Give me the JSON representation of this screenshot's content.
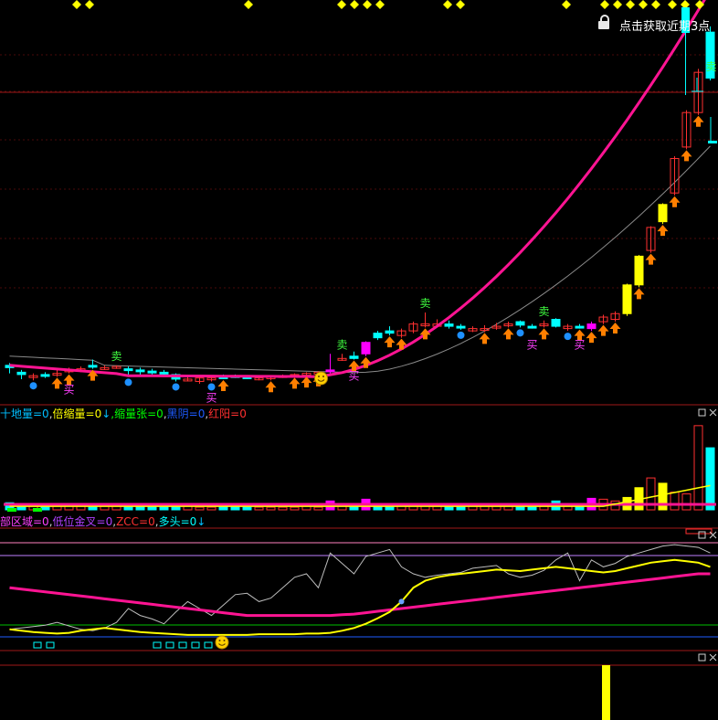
{
  "colors": {
    "bg": "#000000",
    "grid": "#4a0a0a",
    "panel_border": "#a01818",
    "up": "#ff3030",
    "down": "#00ffff",
    "ma_main": "#ff1493",
    "ma_slow": "#8a8a8a",
    "volume_up": "#ff3030",
    "volume_down": "#00ffff",
    "yellow": "#ffff00",
    "arrow": "#ff7f00",
    "buy_text": "#ff40ff",
    "sell_text": "#40ff40",
    "dot": "#1e90ff"
  },
  "header": {
    "lock_icon": "lock-icon",
    "top_text": "点击获取近期3点"
  },
  "panels": {
    "volume": {
      "labels": [
        {
          "text": "十地量=0",
          "color": "#00bfff"
        },
        {
          "text": ",",
          "color": "#cfcfcf"
        },
        {
          "text": "倍缩量=0",
          "color": "#ffff00"
        },
        {
          "text": "↓",
          "color": "#00bfff"
        },
        {
          "text": ",缩量张=0",
          "color": "#00ff00"
        },
        {
          "text": ",",
          "color": "#cfcfcf"
        },
        {
          "text": "黑阴=0",
          "color": "#1e5bff"
        },
        {
          "text": ",",
          "color": "#cfcfcf"
        },
        {
          "text": "红阳=0",
          "color": "#ff3030"
        }
      ]
    },
    "indicator": {
      "labels": [
        {
          "text": "部区域=0",
          "color": "#ff40ff"
        },
        {
          "text": ",",
          "color": "#cfcfcf"
        },
        {
          "text": "低位金叉=0",
          "color": "#b040ff"
        },
        {
          "text": ",",
          "color": "#cfcfcf"
        },
        {
          "text": "ZCC=0",
          "color": "#ff3030"
        },
        {
          "text": ",",
          "color": "#cfcfcf"
        },
        {
          "text": "多头=0",
          "color": "#00ffff"
        },
        {
          "text": "↓",
          "color": "#00bfff"
        }
      ]
    }
  },
  "signals": {
    "buy": "买",
    "sell": "卖"
  },
  "chart_data": {
    "type": "candlestick",
    "series_count": 60,
    "price_note": "relative units (no price axis printed)",
    "candles": [
      [
        50,
        48,
        52,
        43,
        "d"
      ],
      [
        44,
        42,
        46,
        38,
        "d"
      ],
      [
        41,
        40,
        43,
        37,
        "u"
      ],
      [
        42,
        41,
        44,
        39,
        "d"
      ],
      [
        43,
        42,
        46,
        40,
        "u"
      ],
      [
        46,
        45,
        48,
        43,
        "u"
      ],
      [
        47,
        46,
        49,
        44,
        "u"
      ],
      [
        49,
        50,
        55,
        47,
        "d"
      ],
      [
        48,
        47,
        50,
        46,
        "u"
      ],
      [
        49,
        48,
        50,
        47,
        "u"
      ],
      [
        47,
        46,
        49,
        40,
        "d"
      ],
      [
        46,
        45,
        48,
        40,
        "d"
      ],
      [
        45,
        44,
        47,
        42,
        "d"
      ],
      [
        44,
        43,
        46,
        41,
        "d"
      ],
      [
        42,
        38,
        43,
        36,
        "d"
      ],
      [
        38,
        37,
        40,
        36,
        "u"
      ],
      [
        39,
        36,
        40,
        34,
        "u"
      ],
      [
        39,
        38,
        41,
        36,
        "u"
      ],
      [
        40,
        39,
        42,
        38,
        "d"
      ],
      [
        41,
        40,
        42,
        39,
        "d"
      ],
      [
        40,
        39,
        41,
        38,
        "d"
      ],
      [
        39,
        38,
        40,
        37,
        "u"
      ],
      [
        40,
        39,
        41,
        37,
        "u"
      ],
      [
        41,
        40,
        42,
        39,
        "u"
      ],
      [
        42,
        41,
        43,
        40,
        "u"
      ],
      [
        43,
        42,
        44,
        41,
        "u"
      ],
      [
        44,
        43,
        45,
        42,
        "u"
      ],
      [
        46,
        45,
        60,
        43,
        "mu"
      ],
      [
        55,
        56,
        60,
        54,
        "u"
      ],
      [
        56,
        58,
        62,
        55,
        "d"
      ],
      [
        60,
        70,
        71,
        58,
        "mu"
      ],
      [
        74,
        78,
        80,
        72,
        "d"
      ],
      [
        78,
        80,
        84,
        76,
        "d"
      ],
      [
        80,
        76,
        82,
        74,
        "u"
      ],
      [
        80,
        86,
        88,
        78,
        "u"
      ],
      [
        85,
        86,
        96,
        83,
        "u"
      ],
      [
        84,
        86,
        90,
        83,
        "u"
      ],
      [
        86,
        84,
        89,
        82,
        "d"
      ],
      [
        84,
        83,
        86,
        81,
        "d"
      ],
      [
        82,
        80,
        84,
        79,
        "u"
      ],
      [
        81,
        82,
        85,
        79,
        "u"
      ],
      [
        83,
        84,
        87,
        81,
        "u"
      ],
      [
        85,
        86,
        88,
        83,
        "u"
      ],
      [
        85,
        88,
        89,
        83,
        "d"
      ],
      [
        84,
        83,
        86,
        82,
        "d"
      ],
      [
        85,
        86,
        89,
        83,
        "u"
      ],
      [
        84,
        90,
        91,
        83,
        "d"
      ],
      [
        84,
        82,
        86,
        80,
        "u"
      ],
      [
        84,
        84,
        86,
        82,
        "d"
      ],
      [
        86,
        82,
        88,
        80,
        "mu"
      ],
      [
        88,
        92,
        94,
        86,
        "u"
      ],
      [
        90,
        95,
        97,
        88,
        "u"
      ],
      [
        95,
        120,
        121,
        93,
        "y"
      ],
      [
        120,
        145,
        146,
        118,
        "y"
      ],
      [
        150,
        170,
        171,
        148,
        "u"
      ],
      [
        175,
        190,
        191,
        173,
        "y"
      ],
      [
        200,
        230,
        232,
        198,
        "u"
      ],
      [
        240,
        270,
        272,
        238,
        "u"
      ],
      [
        270,
        305,
        308,
        268,
        "u"
      ],
      [
        300,
        340,
        345,
        298,
        "d"
      ]
    ],
    "volume": [
      8,
      6,
      4,
      5,
      4,
      5,
      4,
      6,
      4,
      4,
      5,
      4,
      4,
      3,
      5,
      4,
      3,
      3,
      4,
      3,
      3,
      3,
      3,
      3,
      3,
      4,
      3,
      10,
      4,
      5,
      12,
      4,
      5,
      6,
      5,
      6,
      4,
      4,
      4,
      4,
      4,
      4,
      4,
      5,
      4,
      4,
      10,
      4,
      4,
      13,
      12,
      10,
      14,
      25,
      36,
      30,
      20,
      18,
      95,
      70
    ],
    "indicator_series": {
      "pink": [
        80,
        78,
        76,
        74,
        72,
        70,
        68,
        66,
        64,
        62,
        60,
        58,
        56,
        54,
        52,
        50,
        48,
        46,
        44,
        42,
        40,
        40,
        40,
        40,
        40,
        40,
        40,
        40,
        41,
        42,
        44,
        46,
        48,
        50,
        52,
        54,
        56,
        58,
        60,
        62,
        64,
        66,
        68,
        70,
        72,
        74,
        76,
        78,
        80,
        82,
        84,
        86,
        88,
        90,
        92,
        94,
        96,
        98,
        100,
        100
      ],
      "yellow": [
        20,
        18,
        16,
        15,
        14,
        15,
        18,
        20,
        22,
        20,
        18,
        16,
        15,
        14,
        13,
        12,
        12,
        12,
        12,
        12,
        12,
        13,
        13,
        13,
        13,
        14,
        14,
        15,
        18,
        22,
        28,
        36,
        45,
        60,
        80,
        90,
        95,
        98,
        100,
        102,
        104,
        106,
        105,
        104,
        106,
        108,
        110,
        108,
        106,
        104,
        102,
        104,
        108,
        112,
        116,
        118,
        120,
        118,
        116,
        110
      ],
      "white": [
        20,
        22,
        24,
        26,
        30,
        25,
        20,
        18,
        22,
        30,
        50,
        40,
        35,
        28,
        45,
        60,
        50,
        40,
        55,
        70,
        72,
        60,
        65,
        80,
        95,
        100,
        80,
        130,
        115,
        100,
        125,
        130,
        135,
        110,
        100,
        95,
        98,
        100,
        102,
        108,
        110,
        112,
        100,
        95,
        98,
        105,
        120,
        130,
        90,
        120,
        110,
        115,
        125,
        130,
        135,
        140,
        142,
        140,
        138,
        130
      ]
    }
  }
}
